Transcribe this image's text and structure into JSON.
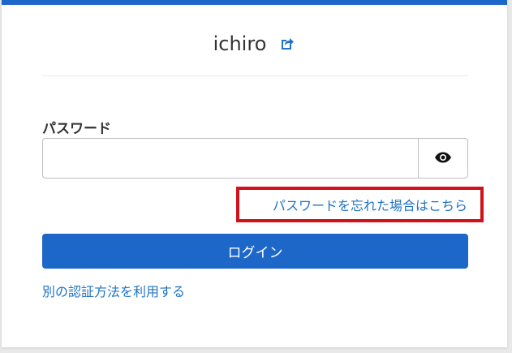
{
  "user": {
    "name": "ichiro",
    "change_icon": "external-link-icon"
  },
  "password": {
    "label": "パスワード",
    "value": "",
    "placeholder": "",
    "reveal_icon": "eye-icon"
  },
  "links": {
    "forgot_password": "パスワードを忘れた場合はこちら",
    "other_method": "別の認証方法を利用する"
  },
  "login_button": "ログイン",
  "colors": {
    "primary": "#1d67c9",
    "link": "#1f73c4",
    "highlight": "#d0121b"
  }
}
